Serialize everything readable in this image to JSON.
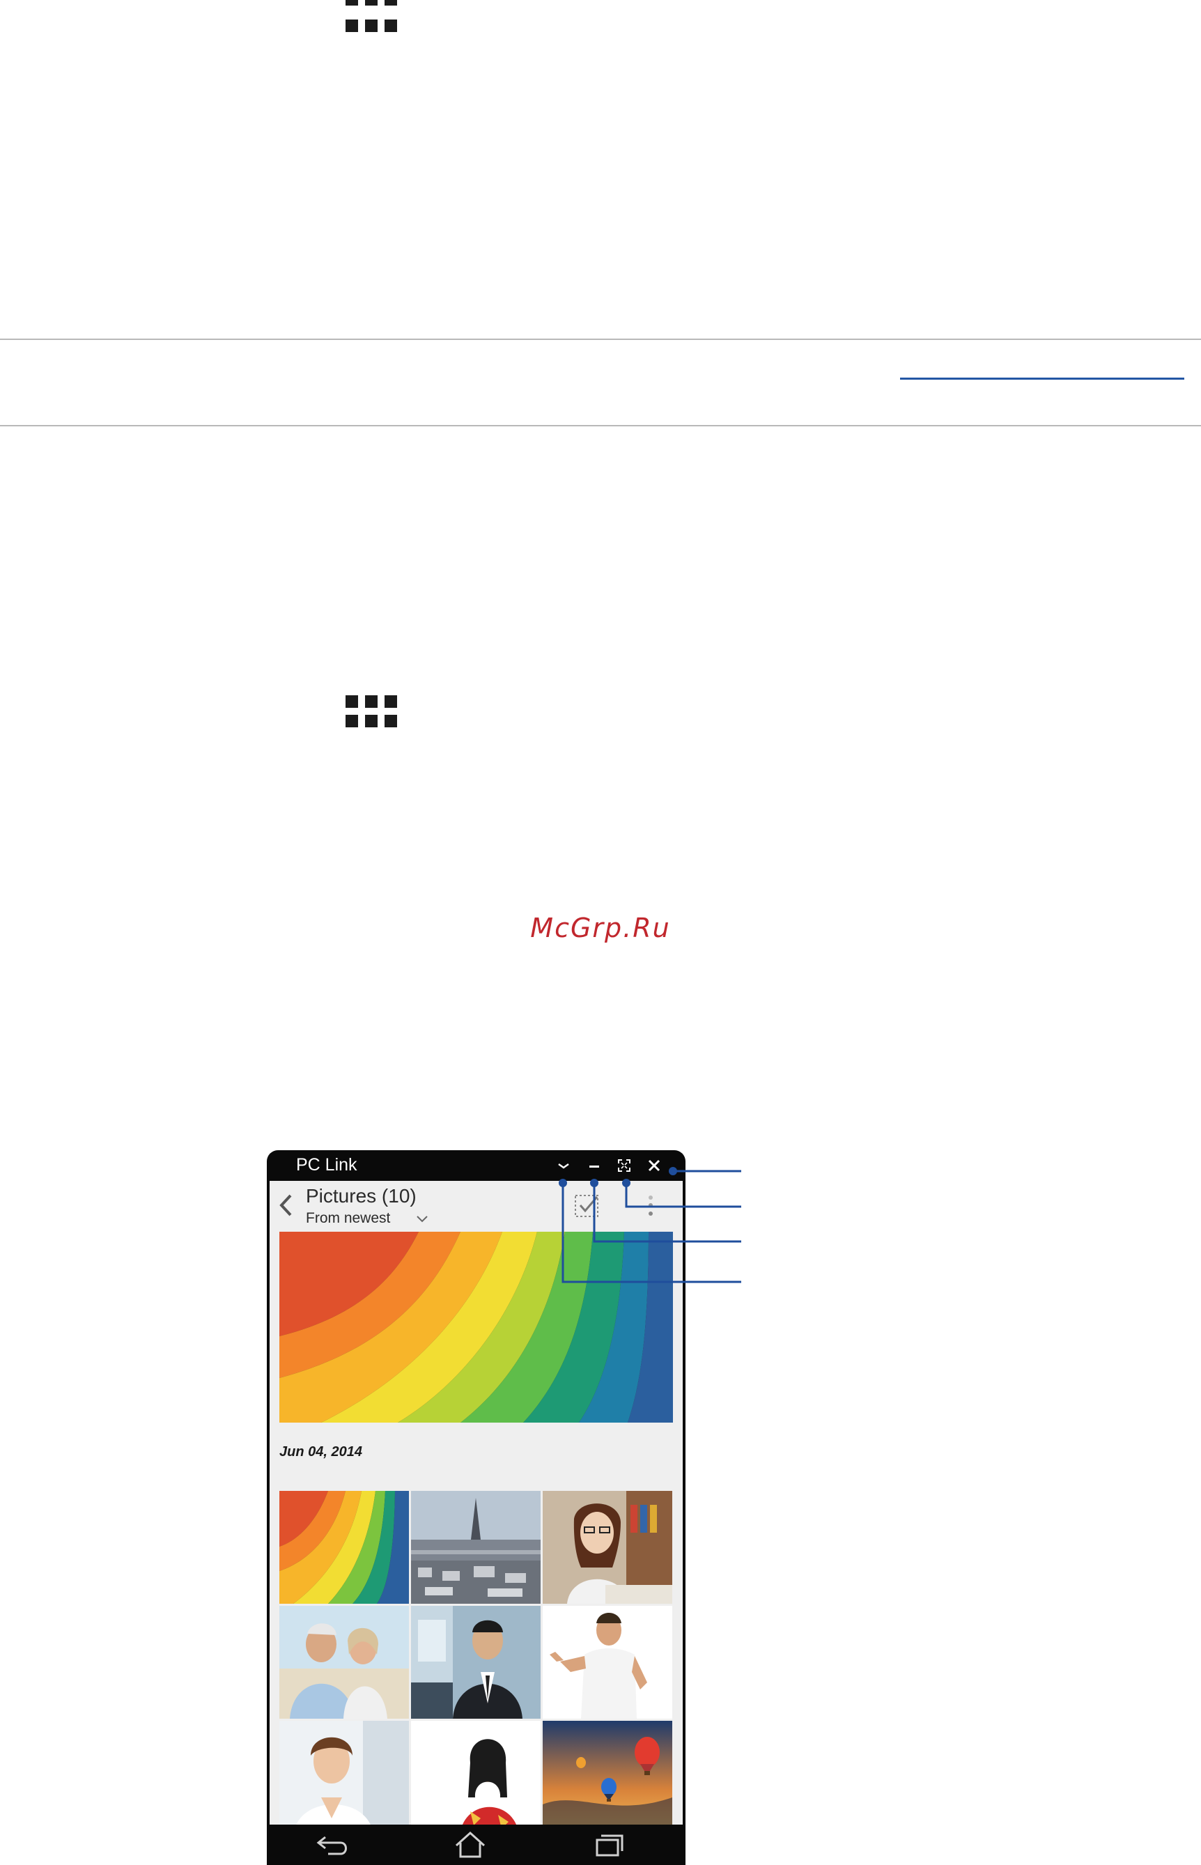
{
  "watermark": "McGrp.Ru",
  "window": {
    "title": "PC Link",
    "buttons": {
      "collapse": "collapse",
      "minimize": "minimize",
      "fullscreen": "fullscreen",
      "close": "close"
    }
  },
  "gallery": {
    "title": "Pictures (10)",
    "sort": "From newest",
    "date": "Jun 04, 2014"
  },
  "icons": {
    "apps": "apps-grid-icon",
    "back": "chevron-left-icon",
    "select": "select-all-icon",
    "more": "more-vertical-icon",
    "nav_back": "back-arrow-icon",
    "nav_home": "home-icon",
    "nav_recent": "recent-apps-icon"
  },
  "colors": {
    "callout": "#1f4e9c",
    "watermark": "#c1272d",
    "titlebar": "#0a0a0a"
  }
}
